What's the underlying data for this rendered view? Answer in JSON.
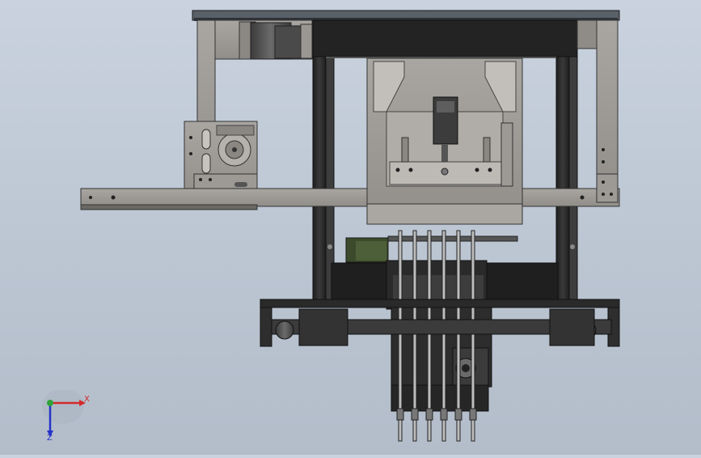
{
  "viewport": {
    "background_top": "#c9d2de",
    "background_bottom": "#b3bdca"
  },
  "triad": {
    "x_label": "X",
    "z_label": "Z",
    "x_color": "#d42a2a",
    "y_color": "#2fa33a",
    "z_color": "#2533c8"
  },
  "model": {
    "frame_color": "#2b2b2b",
    "plate_color": "#a19e99",
    "motor_color": "#4e4e4e",
    "accent_green": "#3b4a2a"
  }
}
